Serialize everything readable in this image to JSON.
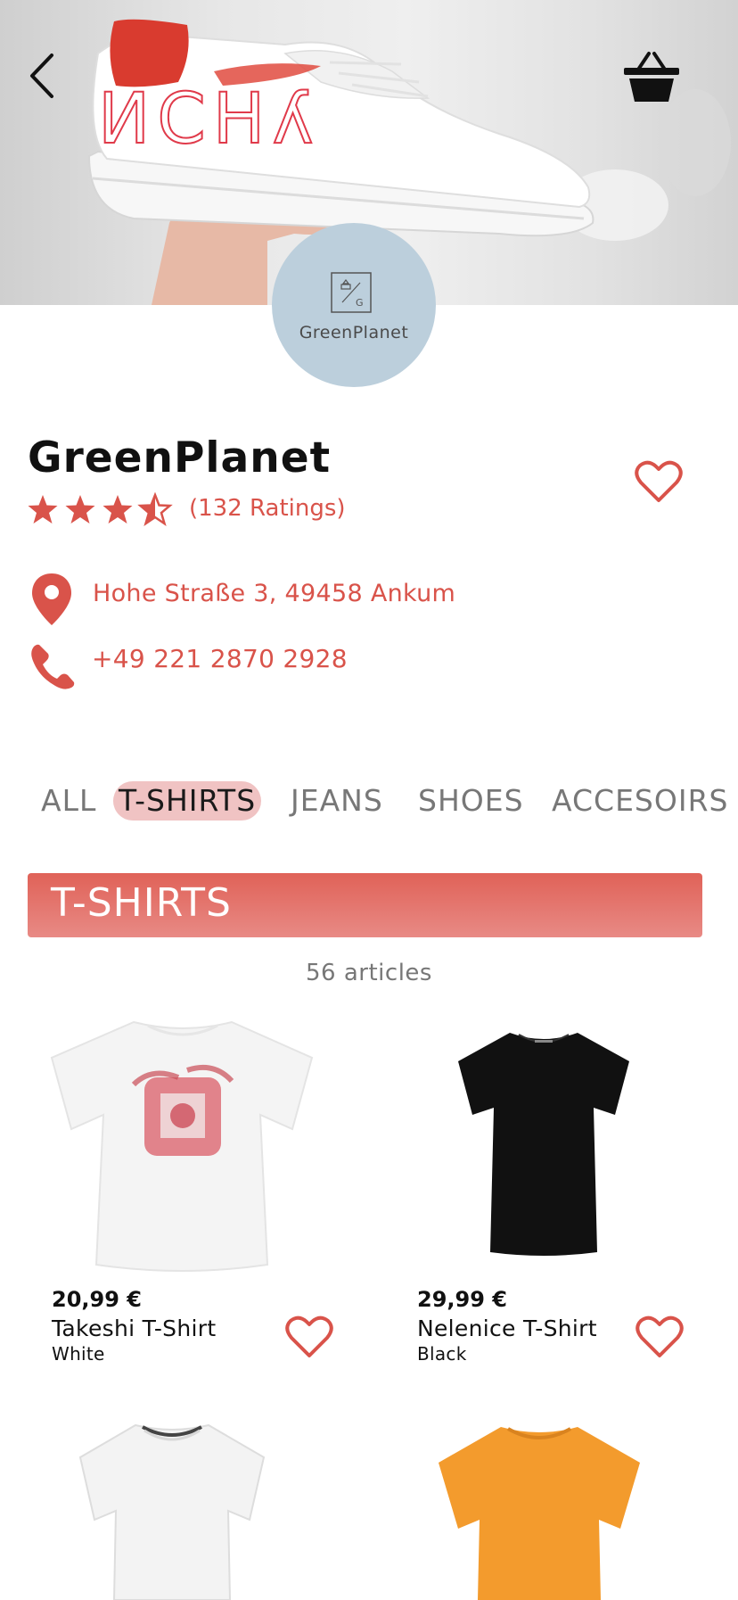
{
  "header": {
    "back_icon": "chevron-left-icon",
    "basket_icon": "basket-icon"
  },
  "store": {
    "logo_text": "GreenPlanet",
    "name": "GreenPlanet",
    "rating_stars": 3.5,
    "rating_max": 5,
    "ratings_label": "(132 Ratings)",
    "address": "Hohe Straße 3, 49458 Ankum",
    "phone": "+49 221 2870 2928",
    "accent_color": "#d9534a"
  },
  "tabs": [
    {
      "label": "ALL",
      "active": false
    },
    {
      "label": "T-SHIRTS",
      "active": true
    },
    {
      "label": "JEANS",
      "active": false
    },
    {
      "label": "SHOES",
      "active": false
    },
    {
      "label": "ACCESOIRS",
      "active": false
    }
  ],
  "section": {
    "title": "T-SHIRTS",
    "count_label": "56 articles"
  },
  "products": [
    {
      "price": "20,99 €",
      "name": "Takeshi T-Shirt",
      "color": "White",
      "shirt_color": "#f4f4f4"
    },
    {
      "price": "29,99 €",
      "name": "Nelenice T-Shirt",
      "color": "Black",
      "shirt_color": "#111111"
    },
    {
      "price": "",
      "name": "",
      "color": "",
      "shirt_color": "#f3f3f3"
    },
    {
      "price": "",
      "name": "",
      "color": "",
      "shirt_color": "#f39b2d"
    }
  ]
}
